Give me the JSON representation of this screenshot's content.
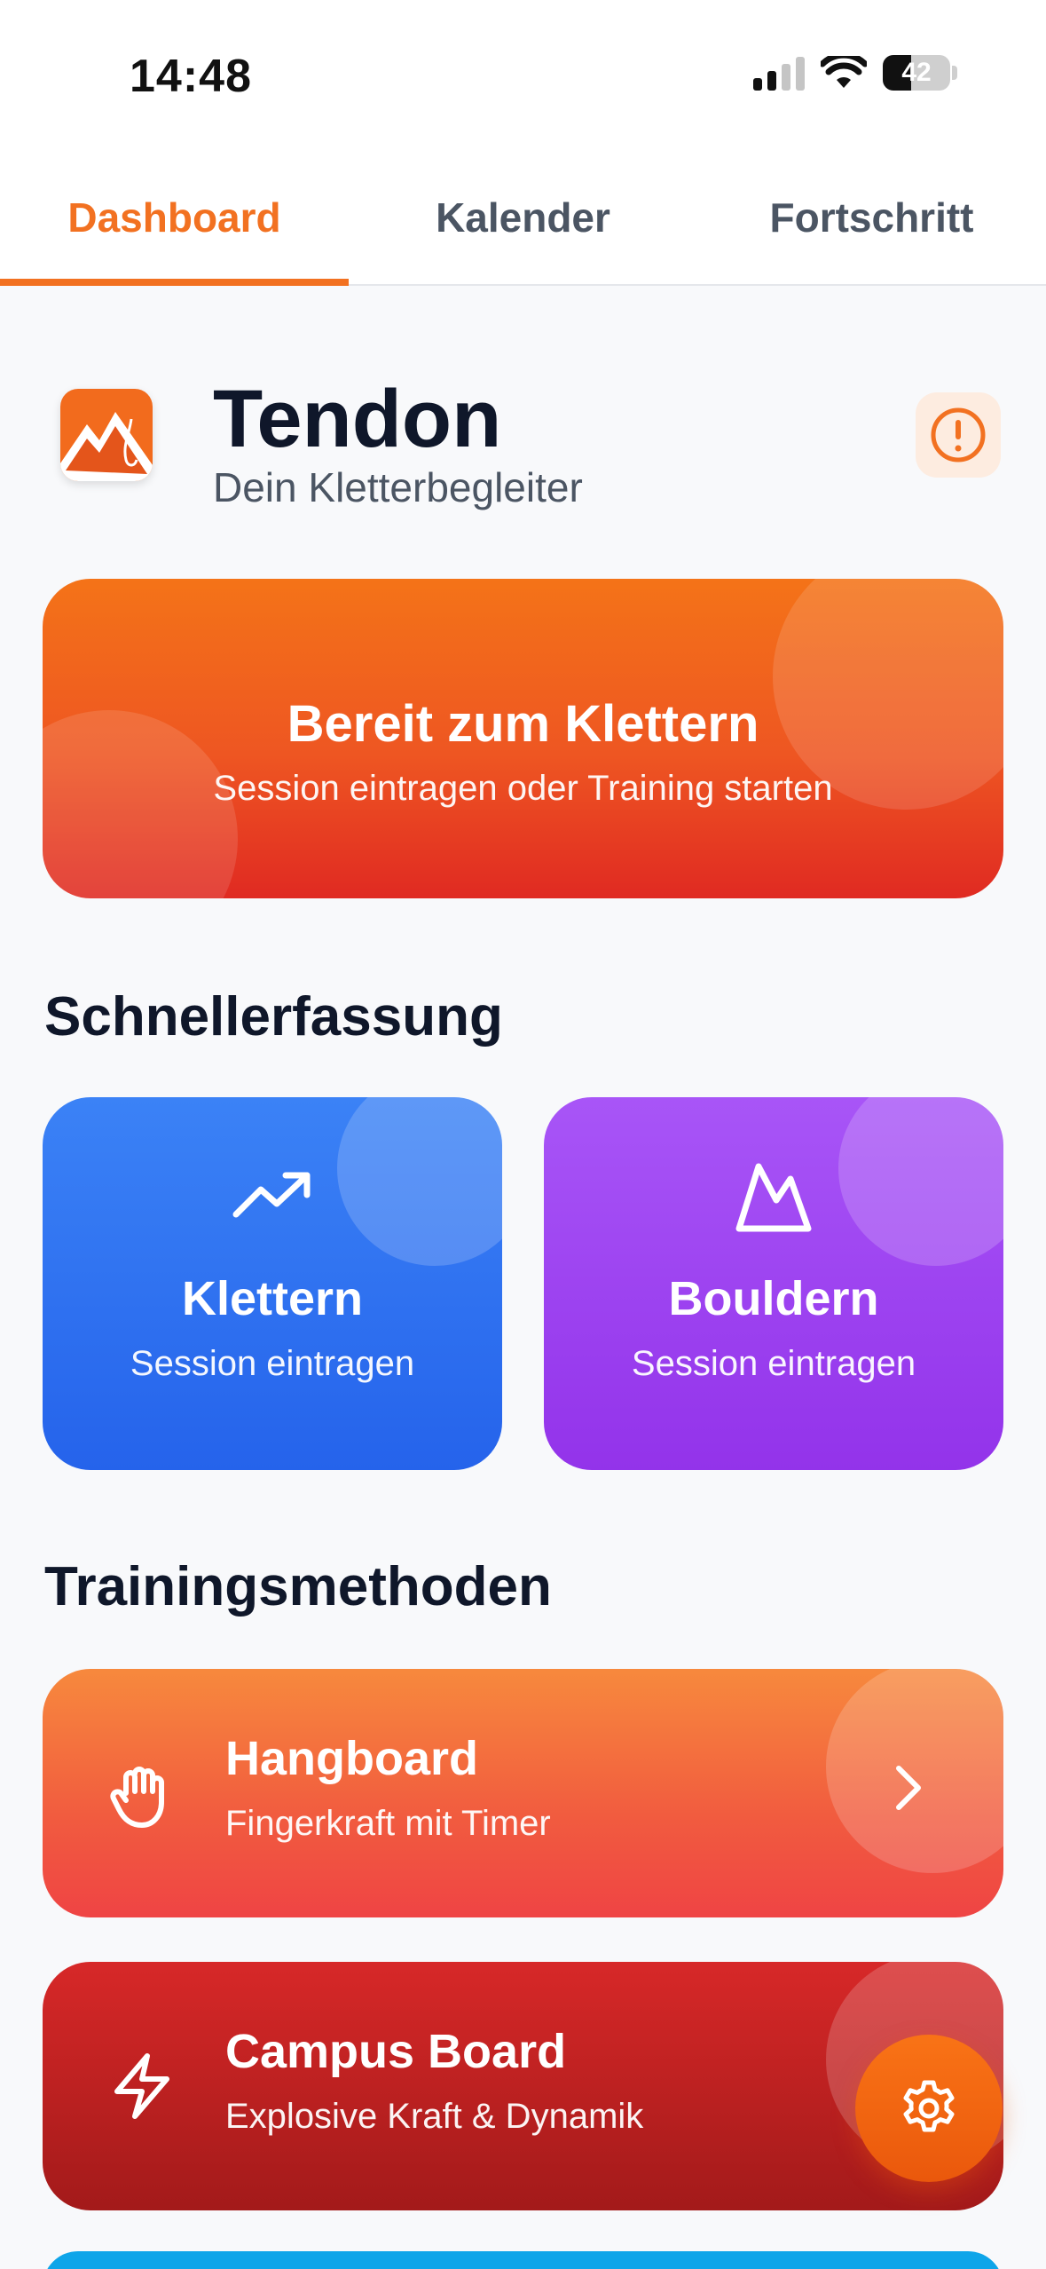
{
  "status_bar": {
    "time": "14:48",
    "battery_level": "42",
    "battery_fraction": 0.42,
    "icons": [
      "signal-icon",
      "wifi-icon",
      "battery-icon"
    ]
  },
  "tabs": [
    {
      "label": "Dashboard",
      "active": true
    },
    {
      "label": "Kalender",
      "active": false
    },
    {
      "label": "Fortschritt",
      "active": false
    }
  ],
  "header": {
    "title": "Tendon",
    "subtitle": "Dein Kletterbegleiter",
    "logo_icon": "mountain-logo-icon",
    "alert_icon": "alert-circle-icon"
  },
  "hero": {
    "title": "Bereit zum Klettern",
    "subtitle": "Session eintragen oder Training starten"
  },
  "quick_section": {
    "title": "Schnellerfassung",
    "cards": [
      {
        "title": "Klettern",
        "subtitle": "Session eintragen",
        "icon": "trending-up-icon",
        "color": "#2563eb"
      },
      {
        "title": "Bouldern",
        "subtitle": "Session eintragen",
        "icon": "mountain-icon",
        "color": "#9333ea"
      }
    ]
  },
  "training_section": {
    "title": "Trainingsmethoden",
    "items": [
      {
        "title": "Hangboard",
        "subtitle": "Fingerkraft mit Timer",
        "icon": "hand-icon",
        "color": "#f15b3f"
      },
      {
        "title": "Campus Board",
        "subtitle": "Explosive Kraft & Dynamik",
        "icon": "lightning-icon",
        "color": "#c02020"
      }
    ]
  },
  "fab": {
    "icon": "gear-icon"
  },
  "colors": {
    "accent": "#f27121",
    "background": "#f8f9fb"
  }
}
